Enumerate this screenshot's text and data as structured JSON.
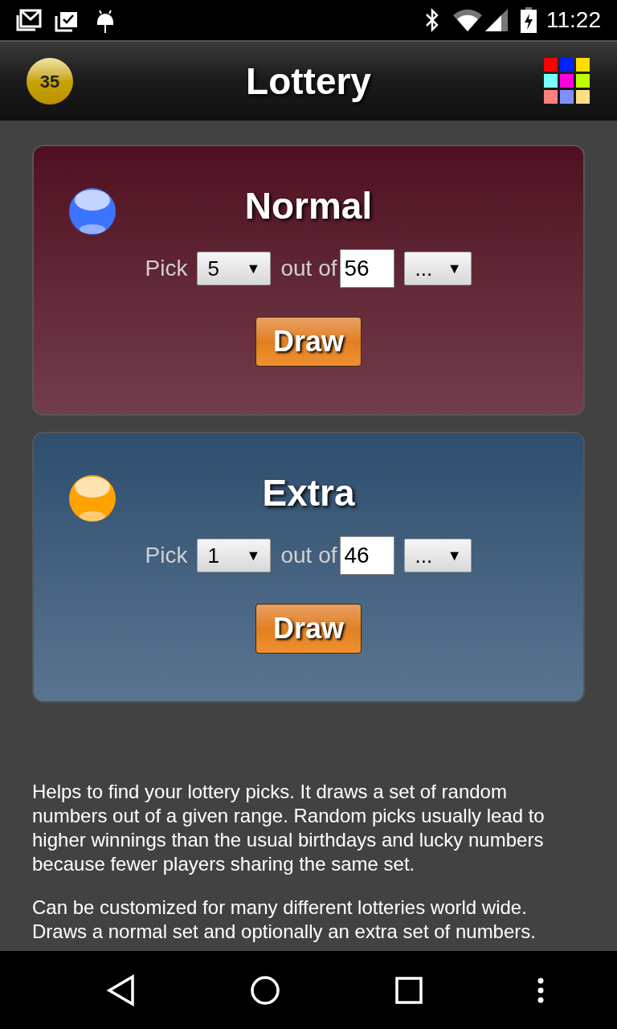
{
  "status_bar": {
    "time": "11:22"
  },
  "app_bar": {
    "title": "Lottery",
    "ball_number": "35"
  },
  "sets": [
    {
      "kind": "normal",
      "title": "Normal",
      "color": "#3d74ff",
      "pick_label": "Pick",
      "pick_value": "5",
      "arrow": "▼",
      "out_of_label": "out of",
      "range_value": "56",
      "preset_value": "...",
      "preset_arrow": "▼",
      "button": "Draw"
    },
    {
      "kind": "extra",
      "title": "Extra",
      "color": "#ffa200",
      "pick_label": "Pick",
      "pick_value": "1",
      "arrow": "▼",
      "out_of_label": "out of",
      "range_value": "46",
      "preset_value": "...",
      "preset_arrow": "▼",
      "button": "Draw"
    }
  ],
  "description": [
    "Helps to find your lottery picks. It draws a set of random numbers out of a given range. Random picks usually lead to higher winnings than the usual birthdays and lucky numbers because fewer players sharing the same set.",
    "Can be customized for many different lotteries world wide. Draws a normal set and optionally an extra set of numbers."
  ]
}
